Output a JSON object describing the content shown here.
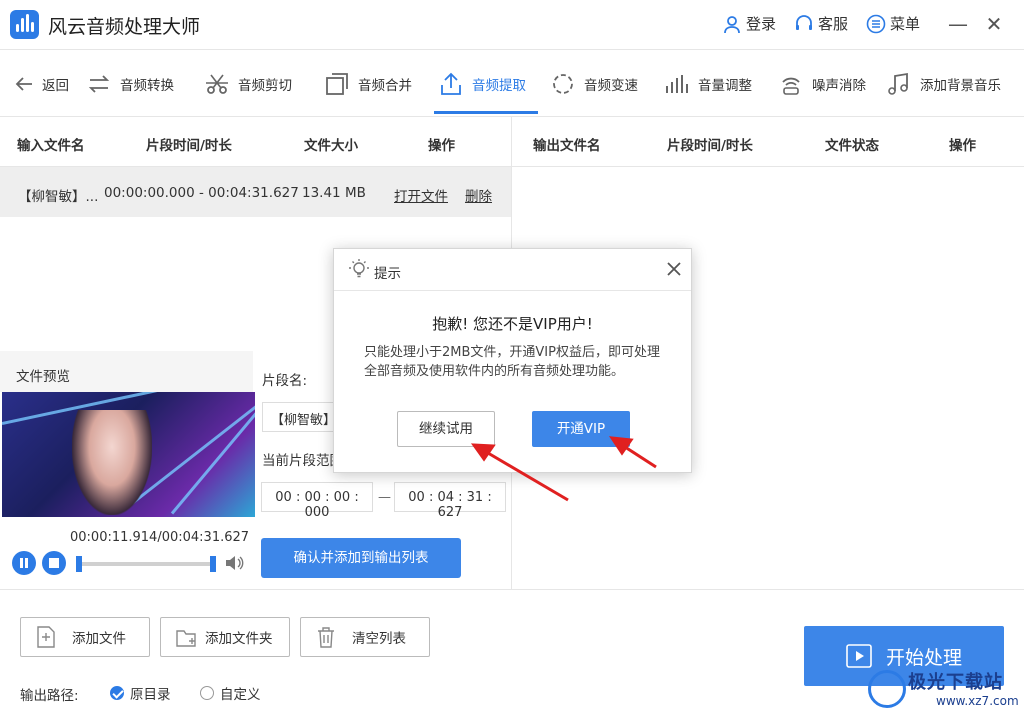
{
  "app": {
    "title": "风云音频处理大师"
  },
  "header": {
    "login": "登录",
    "service": "客服",
    "menu": "菜单"
  },
  "toolbar": {
    "back": "返回",
    "items": [
      "音频转换",
      "音频剪切",
      "音频合并",
      "音频提取",
      "音频变速",
      "音量调整",
      "噪声消除",
      "添加背景音乐"
    ],
    "active_index": 3
  },
  "input_table": {
    "headers": [
      "输入文件名",
      "片段时间/时长",
      "文件大小",
      "操作"
    ],
    "rows": [
      {
        "name": "【柳智敏】...",
        "time": "00:00:00.000 - 00:04:31.627",
        "size": "13.41 MB",
        "open": "打开文件",
        "delete": "删除"
      }
    ]
  },
  "output_table": {
    "headers": [
      "输出文件名",
      "片段时间/时长",
      "文件状态",
      "操作"
    ]
  },
  "preview": {
    "title": "文件预览",
    "time": "00:00:11.914/00:04:31.627",
    "progress": 0.044
  },
  "segment": {
    "name_label": "片段名:",
    "name_value": "【柳智敏】",
    "current_label": "当前片段范围:",
    "start": "00 : 00 : 00 : 000",
    "dash": "—",
    "end": "00 : 04 : 31 : 627",
    "confirm": "确认并添加到输出列表"
  },
  "bottom": {
    "add_file": "添加文件",
    "add_folder": "添加文件夹",
    "clear_list": "清空列表",
    "output_path_label": "输出路径:",
    "option_original": "原目录",
    "option_custom": "自定义",
    "start": "开始处理"
  },
  "dialog": {
    "title": "提示",
    "heading": "抱歉! 您还不是VIP用户!",
    "body": "只能处理小于2MB文件，开通VIP权益后，即可处理全部音频及使用软件内的所有音频处理功能。",
    "continue": "继续试用",
    "vip": "开通VIP"
  },
  "watermark": {
    "text": "极光下载站",
    "url": "www.xz7.com"
  },
  "colors": {
    "accent": "#2c7be5",
    "button_blue": "#3d86e8",
    "arrow_red": "#e02020"
  }
}
